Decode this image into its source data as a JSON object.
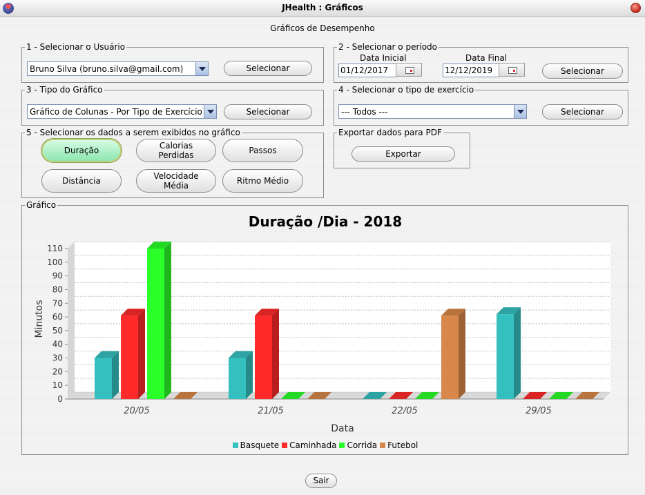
{
  "window": {
    "title": "JHealth : Gráficos"
  },
  "heading": "Gráficos de Desempenho",
  "section_user": {
    "legend": "1 - Selecionar o Usuário",
    "selected_user": "Bruno Silva (bruno.silva@gmail.com)",
    "button": "Selecionar"
  },
  "section_period": {
    "legend": "2 - Selecionar o período",
    "start_label": "Data Inicial",
    "end_label": "Data Final",
    "start_value": "01/12/2017",
    "end_value": "12/12/2019",
    "button": "Selecionar"
  },
  "section_chart_type": {
    "legend": "3 - Tipo do Gráfico",
    "selected_type": "Gráfico de Colunas - Por Tipo de Exercício",
    "button": "Selecionar"
  },
  "section_exercise": {
    "legend": "4 - Selecionar o tipo de exercício",
    "selected_exercise": "--- Todos ---",
    "button": "Selecionar"
  },
  "section_data": {
    "legend": "5 - Selecionar os dados a serem exibidos no gráfico",
    "buttons": {
      "duracao": "Duração",
      "calorias_1": "Calorias",
      "calorias_2": "Perdidas",
      "passos": "Passos",
      "distancia": "Distância",
      "velocidade_1": "Velocidade",
      "velocidade_2": "Média",
      "ritmo": "Ritmo Médio"
    },
    "active": "Duração"
  },
  "section_export": {
    "legend": "Exportar dados para PDF",
    "button": "Exportar"
  },
  "chart_panel": {
    "legend": "Gráfico"
  },
  "footer": {
    "exit_button": "Sair"
  },
  "chart_data": {
    "type": "bar",
    "title": "Duração /Dia - 2018",
    "xlabel": "Data",
    "ylabel": "Minutos",
    "categories": [
      "20/05",
      "21/05",
      "22/05",
      "29/05"
    ],
    "ylim": [
      0,
      110
    ],
    "yticks": [
      0,
      10,
      20,
      30,
      40,
      50,
      60,
      70,
      80,
      90,
      100,
      110
    ],
    "grid": true,
    "legend_position": "bottom",
    "series": [
      {
        "name": "Basquete",
        "color": "#35c0c0",
        "values": [
          30,
          30,
          0,
          62
        ]
      },
      {
        "name": "Caminhada",
        "color": "#ff2a2a",
        "values": [
          61,
          61,
          0,
          0
        ]
      },
      {
        "name": "Corrida",
        "color": "#2aff2a",
        "values": [
          110,
          0,
          0,
          0
        ]
      },
      {
        "name": "Futebol",
        "color": "#d8884a",
        "values": [
          0,
          0,
          61,
          0
        ]
      }
    ]
  }
}
